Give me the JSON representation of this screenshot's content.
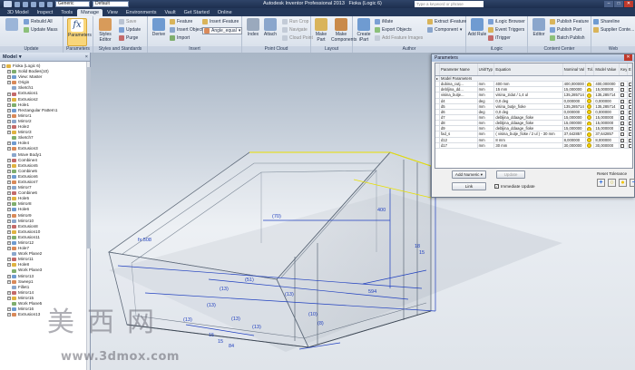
{
  "window": {
    "app_title": "Autodesk Inventor Professional 2013",
    "doc_title": "Fioka (Logic 6)",
    "search_placeholder": "Type a keyword or phrase",
    "style_combo": "Generic",
    "default_combo": "Default",
    "minimize": "–",
    "maximize": "□",
    "close": "✕"
  },
  "tabs": [
    "3D Model",
    "Inspect",
    "Tools",
    "Manage",
    "View",
    "Environments",
    "Vault",
    "Get Started",
    "Online"
  ],
  "active_tab": "Manage",
  "ribbon": {
    "update": {
      "label": "Update",
      "rebuild_all": "Rebuild All",
      "update_mass": "Update Mass"
    },
    "parameters": {
      "label": "Parameters",
      "button": "Parameters"
    },
    "styles": {
      "label": "Styles and Standards",
      "styles_editor": "Styles Editor",
      "save": "Save",
      "update": "Update",
      "purge": "Purge"
    },
    "insert": {
      "label": "Insert",
      "derive": "Derive",
      "feature": "Feature",
      "insert_object": "Insert Object",
      "import": "Import",
      "insert_ifeature": "Insert iFeature",
      "angle_combo": "Angle_equal"
    },
    "point_cloud": {
      "label": "Point Cloud",
      "index": "Index",
      "attach": "Attach",
      "run_crop": "Run Crop",
      "navigate": "Navigate",
      "cloud_point": "Cloud Point"
    },
    "layout": {
      "label": "Layout",
      "make_part": "Make Part",
      "make_components": "Make Components"
    },
    "author": {
      "label": "Author",
      "create_ipart": "Create iPart",
      "imate": "iMate",
      "export_objects": "Export Objects",
      "add_feature_images": "Add Feature Images",
      "extract_ifeature": "Extract iFeature",
      "component": "Component"
    },
    "ilogic": {
      "label": "iLogic",
      "add_rule": "Add Rule",
      "ilogic_browser": "iLogic Browser",
      "event_triggers": "Event Triggers",
      "itrigger": "iTrigger"
    },
    "content_center": {
      "label": "Content Center",
      "editor": "Editor",
      "publish_feature": "Publish Feature",
      "publish_part": "Publish Part",
      "batch_publish": "Batch Publish"
    },
    "web": {
      "label": "Web",
      "shareline": "Shareline",
      "supplier_content": "Supplier Conte..."
    }
  },
  "browser": {
    "title": "Model",
    "items": [
      {
        "label": "Fioka (Logic 6)",
        "level": 0,
        "exp": "-"
      },
      {
        "label": "Solid Bodies(10)",
        "level": 1,
        "exp": "+"
      },
      {
        "label": "View: Master",
        "level": 1,
        "exp": "+"
      },
      {
        "label": "Origin",
        "level": 1,
        "exp": "+"
      },
      {
        "label": "Sketch1",
        "level": 1,
        "exp": ""
      },
      {
        "label": "Extrusion1",
        "level": 1,
        "exp": "+"
      },
      {
        "label": "Extrusion2",
        "level": 1,
        "exp": "+"
      },
      {
        "label": "Hole1",
        "level": 1,
        "exp": "+"
      },
      {
        "label": "Rectangular Pattern1",
        "level": 1,
        "exp": "+"
      },
      {
        "label": "Mirror1",
        "level": 1,
        "exp": "+"
      },
      {
        "label": "Mirror2",
        "level": 1,
        "exp": "+"
      },
      {
        "label": "Hole2",
        "level": 1,
        "exp": "+"
      },
      {
        "label": "Mirror3",
        "level": 1,
        "exp": "+"
      },
      {
        "label": "Sketch7",
        "level": 1,
        "exp": ""
      },
      {
        "label": "Hole4",
        "level": 1,
        "exp": "+"
      },
      {
        "label": "Extrusion3",
        "level": 1,
        "exp": "+"
      },
      {
        "label": "Move Body1",
        "level": 1,
        "exp": ""
      },
      {
        "label": "Combine4",
        "level": 1,
        "exp": "+"
      },
      {
        "label": "Extrusion5",
        "level": 1,
        "exp": "+"
      },
      {
        "label": "Combine5",
        "level": 1,
        "exp": "+"
      },
      {
        "label": "Extrusion6",
        "level": 1,
        "exp": "+"
      },
      {
        "label": "Extrusion7",
        "level": 1,
        "exp": "+"
      },
      {
        "label": "Mirror7",
        "level": 1,
        "exp": "+"
      },
      {
        "label": "Combine6",
        "level": 1,
        "exp": "+"
      },
      {
        "label": "Hole5",
        "level": 1,
        "exp": "+"
      },
      {
        "label": "Mirror8",
        "level": 1,
        "exp": "+"
      },
      {
        "label": "Hole6",
        "level": 1,
        "exp": "+"
      },
      {
        "label": "Mirror9",
        "level": 1,
        "exp": "+"
      },
      {
        "label": "Mirror10",
        "level": 1,
        "exp": "+"
      },
      {
        "label": "Extrusion8",
        "level": 1,
        "exp": "+"
      },
      {
        "label": "Extrusion10",
        "level": 1,
        "exp": "+"
      },
      {
        "label": "Extrusion11",
        "level": 1,
        "exp": "+"
      },
      {
        "label": "Mirror12",
        "level": 1,
        "exp": "+"
      },
      {
        "label": "Hole7",
        "level": 1,
        "exp": "+"
      },
      {
        "label": "Work Plane2",
        "level": 1,
        "exp": ""
      },
      {
        "label": "Mirror11",
        "level": 1,
        "exp": "+"
      },
      {
        "label": "Hole8",
        "level": 1,
        "exp": "+"
      },
      {
        "label": "Work Plane3",
        "level": 1,
        "exp": ""
      },
      {
        "label": "Mirror13",
        "level": 1,
        "exp": "+"
      },
      {
        "label": "Sweep1",
        "level": 1,
        "exp": "+"
      },
      {
        "label": "Fillet1",
        "level": 1,
        "exp": ""
      },
      {
        "label": "Mirror14",
        "level": 1,
        "exp": "+"
      },
      {
        "label": "Mirror15",
        "level": 1,
        "exp": "+"
      },
      {
        "label": "Work Plane5",
        "level": 1,
        "exp": ""
      },
      {
        "label": "Mirror16",
        "level": 1,
        "exp": "+"
      },
      {
        "label": "Extrusion13",
        "level": 1,
        "exp": "+"
      }
    ]
  },
  "parameters_dialog": {
    "title": "Parameters",
    "close": "✕",
    "columns": [
      "Parameter Name",
      "Unit/Typ",
      "Equation",
      "Nominal Val",
      "Tol.",
      "Model Value",
      "Key",
      "Ex"
    ],
    "group": "Model Parameters",
    "rows": [
      {
        "name": "dubina_cutj...",
        "unit": "mm",
        "eq": "400 mm",
        "nom": "400,000000",
        "model": "400,000000"
      },
      {
        "name": "debljina_dd...",
        "unit": "mm",
        "eq": "15 mm",
        "nom": "15,000000",
        "model": "15,000000"
      },
      {
        "name": "visina_butje...",
        "unit": "mm",
        "eq": "visina_zidut / 1,4 ul",
        "nom": "135,285714",
        "model": "135,285714"
      },
      {
        "name": "d4",
        "unit": "deg",
        "eq": "0,0 deg",
        "nom": "0,000000",
        "model": "0,000000"
      },
      {
        "name": "d5",
        "unit": "mm",
        "eq": "visina_butje_fioke",
        "nom": "135,285714",
        "model": "135,285714"
      },
      {
        "name": "d6",
        "unit": "deg",
        "eq": "0,0 deg",
        "nom": "0,000000",
        "model": "0,000000"
      },
      {
        "name": "d7",
        "unit": "mm",
        "eq": "debljina_ddaage_fioke",
        "nom": "15,000000",
        "model": "15,000000"
      },
      {
        "name": "d8",
        "unit": "mm",
        "eq": "debljina_ddaage_fioke",
        "nom": "15,000000",
        "model": "15,000000"
      },
      {
        "name": "d9",
        "unit": "mm",
        "eq": "debljina_ddaage_fioke",
        "nom": "15,000000",
        "model": "15,000000"
      },
      {
        "name": "fad_s",
        "unit": "mm",
        "eq": "( visina_butje_fioke / 2 ul ) - 30 mm",
        "nom": "37,642857",
        "model": "37,642857"
      },
      {
        "name": "d12",
        "unit": "mm",
        "eq": "8 mm",
        "nom": "8,000000",
        "model": "8,000000"
      },
      {
        "name": "d17",
        "unit": "mm",
        "eq": "30 mm",
        "nom": "30,000000",
        "model": "30,000000"
      }
    ],
    "add_numeric": "Add Numeric",
    "update": "Update",
    "link": "Link",
    "immediate_update": "Immediate Update",
    "reset_tolerance": "Reset Tolerance"
  },
  "viewport": {
    "dims": [
      "R",
      "(70)",
      "400",
      "594",
      "(51)",
      "(13)",
      "(13)",
      "(10)",
      "(8)",
      "(13)",
      "(13)",
      "(13)",
      "(13)",
      "fx:508",
      "18",
      "15",
      "84",
      "15",
      "15"
    ],
    "dim_color": "#1f3fbf"
  },
  "watermark": {
    "cn": "美西网",
    "url": "www.3dmox.com"
  }
}
